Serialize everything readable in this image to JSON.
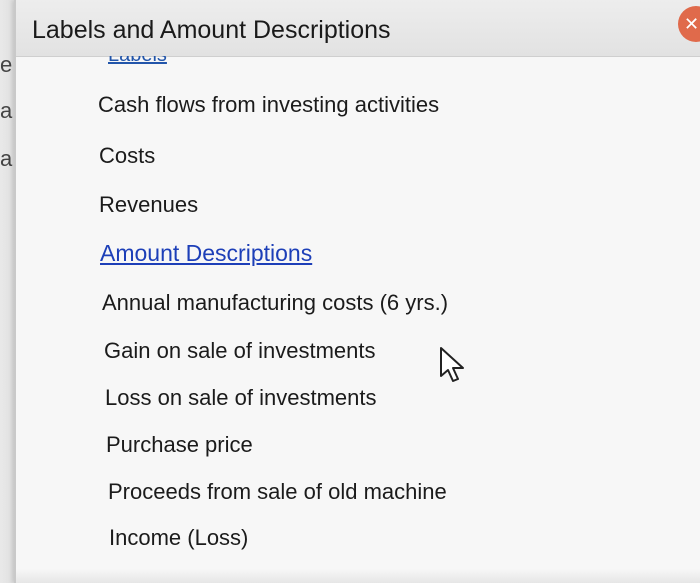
{
  "background_fragments": [
    "e",
    "a",
    "a"
  ],
  "popup": {
    "title": "Labels and Amount Descriptions",
    "close_glyph": "✕"
  },
  "labels_heading": "Labels",
  "labels_items": [
    "Cash flows from investing activities",
    "Costs",
    "Revenues"
  ],
  "amount_heading": "Amount Descriptions",
  "amount_items": [
    "Annual manufacturing costs (6 yrs.)",
    "Gain on sale of investments",
    "Loss on sale of investments",
    "Purchase price",
    "Proceeds from sale of old machine",
    "Income (Loss)"
  ],
  "colors": {
    "link_heading": "#1d3fb8",
    "close_button": "#e06a4b"
  },
  "icons": {
    "cursor": "mouse-pointer-icon",
    "close": "close-icon"
  }
}
